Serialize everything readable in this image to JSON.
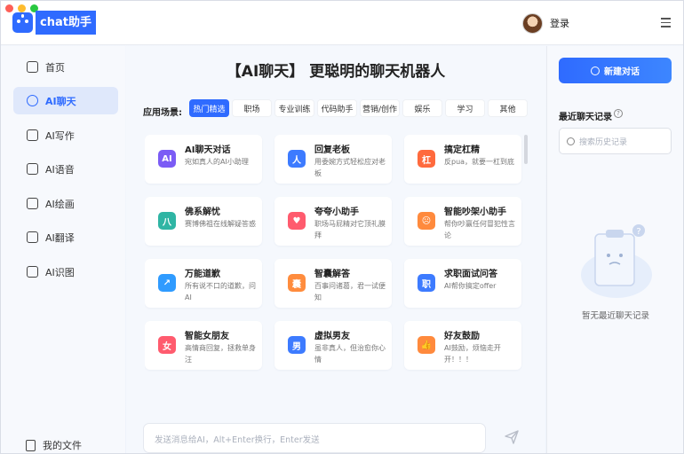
{
  "app": {
    "title": "chat助手",
    "login": "登录"
  },
  "sidebar": {
    "items": [
      {
        "label": "首页",
        "icon": "home-icon"
      },
      {
        "label": "AI聊天",
        "icon": "chat-icon",
        "active": true
      },
      {
        "label": "AI写作",
        "icon": "pen-icon"
      },
      {
        "label": "AI语音",
        "icon": "voice-icon"
      },
      {
        "label": "AI绘画",
        "icon": "palette-icon"
      },
      {
        "label": "AI翻译",
        "icon": "translate-icon"
      },
      {
        "label": "AI识图",
        "icon": "image-scan-icon"
      }
    ],
    "files": "我的文件"
  },
  "main": {
    "headline": "【AI聊天】 更聪明的聊天机器人",
    "scene_label": "应用场景:",
    "chips": [
      "热门精选",
      "职场",
      "专业训练",
      "代码助手",
      "营销/创作",
      "娱乐",
      "学习",
      "其他"
    ],
    "cards": [
      {
        "title": "AI聊天对话",
        "desc": "宛如真人的AI小助理",
        "color": "#7b5cf5",
        "glyph": "AI"
      },
      {
        "title": "回复老板",
        "desc": "用委婉方式轻松应对老板",
        "color": "#3d7bff",
        "glyph": "人"
      },
      {
        "title": "搞定杠精",
        "desc": "反pua，就要一杠到底",
        "color": "#ff6a3d",
        "glyph": "杠"
      },
      {
        "title": "佛系解忧",
        "desc": "赛博佛祖在线解疑答惑",
        "color": "#2fb5a4",
        "glyph": "八"
      },
      {
        "title": "夸夸小助手",
        "desc": "职场马屁精对它顶礼膜拜",
        "color": "#ff5b6e",
        "glyph": "♥"
      },
      {
        "title": "智能吵架小助手",
        "desc": "帮你吵赢任何冒犯性言论",
        "color": "#ff8a3d",
        "glyph": "☹"
      },
      {
        "title": "万能道歉",
        "desc": "所有说不口的道歉，问AI",
        "color": "#2f9bff",
        "glyph": "↗"
      },
      {
        "title": "智囊解答",
        "desc": "百事问诸葛，君一试便知",
        "color": "#ff8c3d",
        "glyph": "囊"
      },
      {
        "title": "求职面试问答",
        "desc": "AI帮你搞定offer",
        "color": "#3d7bff",
        "glyph": "职"
      },
      {
        "title": "智能女朋友",
        "desc": "高情商回复，拯救单身汪",
        "color": "#ff5b6e",
        "glyph": "女"
      },
      {
        "title": "虚拟男友",
        "desc": "虽非真人，但治愈你心情",
        "color": "#3d7bff",
        "glyph": "男"
      },
      {
        "title": "好友鼓励",
        "desc": "AI鼓励，烦恼走开开！！！",
        "color": "#ff8a3d",
        "glyph": "👍"
      }
    ],
    "input_placeholder": "发送消息给AI，Alt+Enter换行，Enter发送"
  },
  "right": {
    "new_chat": "新建对话",
    "recent_title": "最近聊天记录",
    "search_placeholder": "搜索历史记录",
    "empty_text": "暂无最近聊天记录"
  },
  "colors": {
    "accent": "#2f6bff"
  }
}
